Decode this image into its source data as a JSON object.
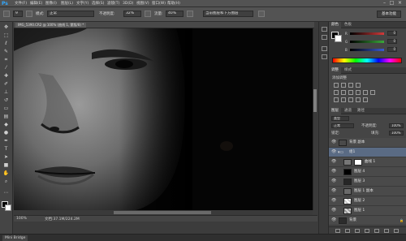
{
  "app": {
    "logo": "Ps"
  },
  "menubar": {
    "items": [
      "文件(F)",
      "编辑(E)",
      "图像(I)",
      "图层(L)",
      "文字(Y)",
      "选择(S)",
      "滤镜(T)",
      "3D(D)",
      "视图(V)",
      "窗口(W)",
      "帮助(H)"
    ],
    "window_buttons": [
      "–",
      "□",
      "×"
    ]
  },
  "options_bar": {
    "tool_preset_icon": "brush-icon",
    "size": "9",
    "mode_label": "模式:",
    "mode_value": "正常",
    "opacity_label": "不透明度:",
    "opacity_value": "32%",
    "flow_label": "流量:",
    "flow_value": "40%",
    "preset_value": "当前图层和下方图层",
    "workspace": "基本功能"
  },
  "document": {
    "tab_label": "IMG_5390.CR2 @ 100% (曲线 1, 蒙版/8) *",
    "zoom": "100%",
    "doc_info": "文档:37.1M/224.2M"
  },
  "bottom": {
    "mini_bridge": "Mini Bridge"
  },
  "color_panel": {
    "tabs": [
      "颜色",
      "色板"
    ],
    "channels": [
      {
        "label": "R",
        "value": "0",
        "color": "#d33a3a"
      },
      {
        "label": "G",
        "value": "0",
        "color": "#3aa83a"
      },
      {
        "label": "B",
        "value": "0",
        "color": "#3a5ad3"
      }
    ]
  },
  "adjust_panel": {
    "tabs": [
      "调整",
      "样式"
    ],
    "title": "添加调整"
  },
  "layers_panel": {
    "tabs": [
      "图层",
      "通道",
      "路径"
    ],
    "kind_label": "类型",
    "blend_mode": "正常",
    "opacity_label": "不透明度:",
    "opacity_value": "100%",
    "lock_label": "锁定:",
    "fill_label": "填充:",
    "fill_value": "100%",
    "layers": [
      {
        "name": "背景 副本",
        "thumb": "#4a4a4a",
        "selected": false
      },
      {
        "name": "组1",
        "thumb": "folder",
        "selected": true
      },
      {
        "name": "曲线 1",
        "thumb": "#ffffff",
        "selected": false
      },
      {
        "name": "图层 4",
        "thumb": "#000000",
        "selected": false
      },
      {
        "name": "图层 3",
        "thumb": "#262626",
        "selected": false
      },
      {
        "name": "图层 1 副本",
        "thumb": "#6a6a6a",
        "selected": false
      },
      {
        "name": "图层 2",
        "thumb": "#ffffff",
        "selected": false
      },
      {
        "name": "图层 1",
        "thumb": "#bbbbbb",
        "selected": false
      },
      {
        "name": "背景",
        "thumb": "#2c2c2c",
        "selected": false
      }
    ]
  }
}
